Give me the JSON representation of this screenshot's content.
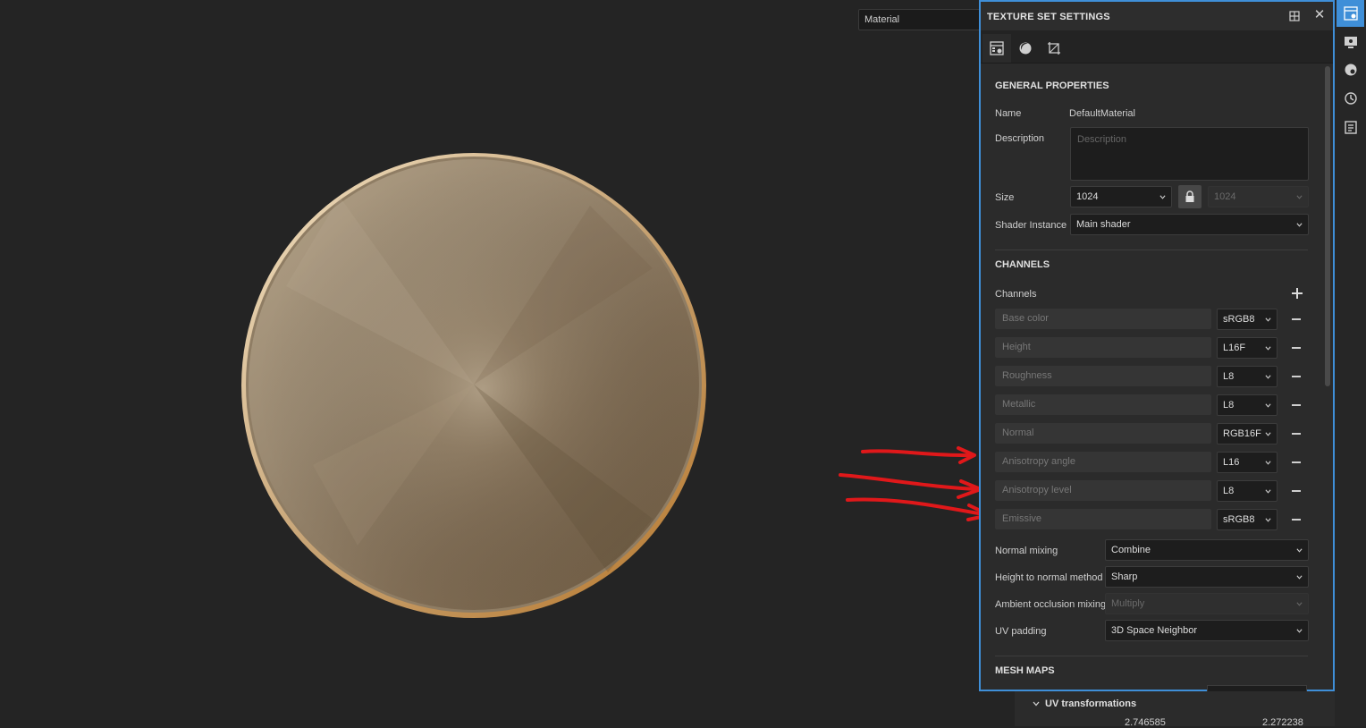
{
  "viewport": {
    "material_dropdown": "Material"
  },
  "panel": {
    "title": "TEXTURE SET SETTINGS",
    "tabs": [
      {
        "icon": "texture-set-settings-icon",
        "active": true
      },
      {
        "icon": "sphere-material-icon",
        "active": false
      },
      {
        "icon": "uv-crop-icon",
        "active": false
      }
    ],
    "general": {
      "section_title": "GENERAL PROPERTIES",
      "name_label": "Name",
      "name_value": "DefaultMaterial",
      "description_label": "Description",
      "description_placeholder": "Description",
      "size_label": "Size",
      "size_value": "1024",
      "size_locked_value": "1024",
      "shader_label": "Shader Instance",
      "shader_value": "Main shader"
    },
    "channels": {
      "section_title": "CHANNELS",
      "list_label": "Channels",
      "items": [
        {
          "name": "Base color",
          "format": "sRGB8"
        },
        {
          "name": "Height",
          "format": "L16F"
        },
        {
          "name": "Roughness",
          "format": "L8"
        },
        {
          "name": "Metallic",
          "format": "L8"
        },
        {
          "name": "Normal",
          "format": "RGB16F"
        },
        {
          "name": "Anisotropy angle",
          "format": "L16"
        },
        {
          "name": "Anisotropy level",
          "format": "L8"
        },
        {
          "name": "Emissive",
          "format": "sRGB8"
        }
      ],
      "normal_mixing_label": "Normal mixing",
      "normal_mixing_value": "Combine",
      "height_to_normal_label": "Height to normal method",
      "height_to_normal_value": "Sharp",
      "ao_mixing_label": "Ambient occlusion mixing",
      "ao_mixing_value": "Multiply",
      "uv_padding_label": "UV padding",
      "uv_padding_value": "3D Space Neighbor"
    },
    "mesh_maps": {
      "section_title": "MESH MAPS"
    }
  },
  "uv_transformations": {
    "title": "UV transformations",
    "value_1": "2.746585",
    "value_2": "2.272238"
  },
  "colors": {
    "accent": "#3f8fd8",
    "annotation": "#e0181a",
    "disc_metal": "#8d7557"
  }
}
